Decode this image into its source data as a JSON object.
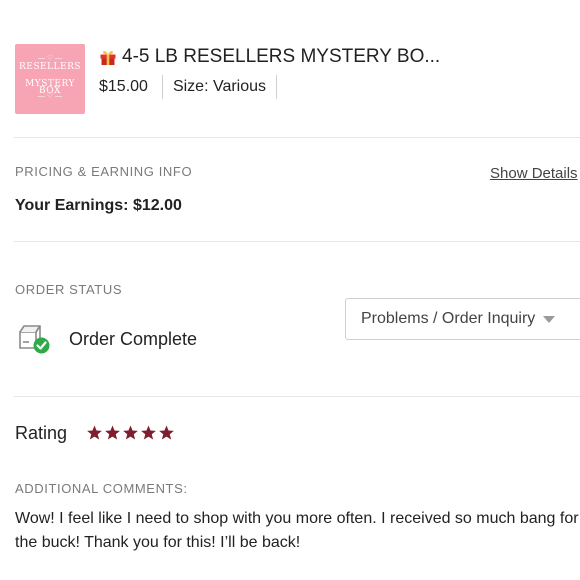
{
  "product": {
    "thumbnail_text_line1": "RESELLERS",
    "thumbnail_text_line2": "MYSTERY BOX",
    "title": "4-5 LB RESELLERS MYSTERY BO...",
    "price": "$15.00",
    "size": "Size: Various",
    "icon": "gift-icon"
  },
  "pricing": {
    "section_label": "PRICING & EARNING INFO",
    "show_details": "Show Details",
    "earnings": "Your Earnings: $12.00"
  },
  "order_status": {
    "section_label": "ORDER STATUS",
    "status": "Order Complete",
    "icon": "package-check-icon",
    "inquiry_label": "Problems / Order Inquiry"
  },
  "rating": {
    "label": "Rating",
    "stars": 5,
    "max_stars": 5,
    "star_color": "#7d1f2e"
  },
  "comments": {
    "section_label": "ADDITIONAL COMMENTS:",
    "text": "Wow! I feel like I need to shop with you more often. I received so much bang for the buck! Thank you for this! I’ll be back!"
  },
  "colors": {
    "thumbnail_bg": "#f7a4b5",
    "check_green": "#2faa4a",
    "divider": "#e6e6e6",
    "muted_label": "#7a7a7a"
  }
}
